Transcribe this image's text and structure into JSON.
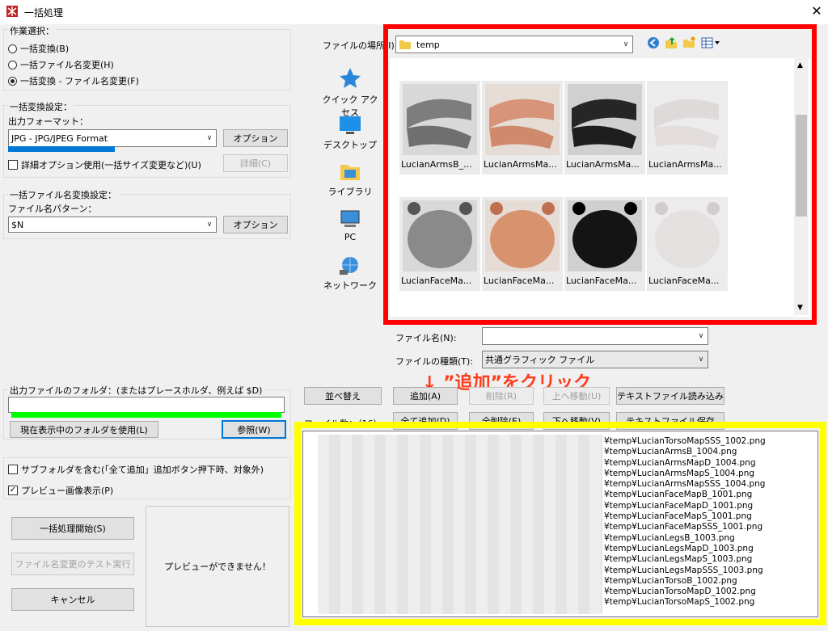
{
  "window": {
    "title": "一括処理",
    "close_glyph": "✕"
  },
  "operation": {
    "label": "作業選択：",
    "options": [
      {
        "label": "一括変換(B)",
        "selected": false
      },
      {
        "label": "一括ファイル名変更(H)",
        "selected": false
      },
      {
        "label": "一括変換 - ファイル名変更(F)",
        "selected": true
      }
    ]
  },
  "convert": {
    "label": "一括変換設定：",
    "format_label": "出力フォーマット：",
    "format_value": "JPG - JPG/JPEG Format",
    "option_button": "オプション",
    "detail_check": "詳細オプション使用(一括サイズ変更など)(U)",
    "detail_button": "詳細(C)"
  },
  "rename": {
    "label": "一括ファイル名変換設定：",
    "pattern_label": "ファイル名パターン：",
    "pattern_value": "$N",
    "option_button": "オプション"
  },
  "output": {
    "label": "出力ファイルのフォルダ：(またはプレースホルダ、例えば $D)",
    "use_current_button": "現在表示中のフォルダを使用(L)",
    "browse_button": "参照(W)"
  },
  "checks": {
    "subfolder": "サブフォルダを含む(「全て追加」追加ボタン押下時、対象外)",
    "preview": "プレビュー画像表示(P)"
  },
  "actions": {
    "start": "一括処理開始(S)",
    "test": "ファイル名変更のテスト実行",
    "cancel": "キャンセル",
    "preview_msg": "プレビューができません！"
  },
  "browser": {
    "location_label": "ファイルの場所(I):",
    "location_value": "temp",
    "nav": [
      {
        "label": "クイック アクセス",
        "icon": "star-icon"
      },
      {
        "label": "デスクトップ",
        "icon": "desktop-icon"
      },
      {
        "label": "ライブラリ",
        "icon": "library-icon"
      },
      {
        "label": "PC",
        "icon": "pc-icon"
      },
      {
        "label": "ネットワーク",
        "icon": "network-icon"
      }
    ],
    "thumbnails": [
      "LucianArmsB_...",
      "LucianArmsMa...",
      "LucianArmsMa...",
      "LucianArmsMa...",
      "LucianFaceMa...",
      "LucianFaceMa...",
      "LucianFaceMa...",
      "LucianFaceMa..."
    ],
    "filename_label": "ファイル名(N):",
    "filetype_label": "ファイルの種類(T):",
    "filetype_value": "共通グラフィック ファイル"
  },
  "list_buttons": {
    "sort": "並べ替え",
    "add": "追加(A)",
    "remove": "削除(R)",
    "move_up": "上へ移動(U)",
    "read_text": "テキストファイル読み込み",
    "add_all": "全て追加(D)",
    "remove_all": "全削除(E)",
    "move_down": "下へ移動(V)",
    "save_text": "テキストファイル保存",
    "file_count_label": "ファイル数：（16）"
  },
  "annotation": "↓ ”追加”をクリック",
  "file_list": [
    "¥temp¥LucianTorsoMapSSS_1002.png",
    "¥temp¥LucianArmsB_1004.png",
    "¥temp¥LucianArmsMapD_1004.png",
    "¥temp¥LucianArmsMapS_1004.png",
    "¥temp¥LucianArmsMapSSS_1004.png",
    "¥temp¥LucianFaceMapB_1001.png",
    "¥temp¥LucianFaceMapD_1001.png",
    "¥temp¥LucianFaceMapS_1001.png",
    "¥temp¥LucianFaceMapSSS_1001.png",
    "¥temp¥LucianLegsB_1003.png",
    "¥temp¥LucianLegsMapD_1003.png",
    "¥temp¥LucianLegsMapS_1003.png",
    "¥temp¥LucianLegsMapSSS_1003.png",
    "¥temp¥LucianTorsoB_1002.png",
    "¥temp¥LucianTorsoMapD_1002.png",
    "¥temp¥LucianTorsoMapS_1002.png"
  ],
  "colors": {
    "highlight_red": "#ff0000",
    "highlight_yellow": "#ffff00",
    "annotation": "#ff3a1a",
    "focus_blue": "#0078d7",
    "progress_green": "#00ff00"
  }
}
